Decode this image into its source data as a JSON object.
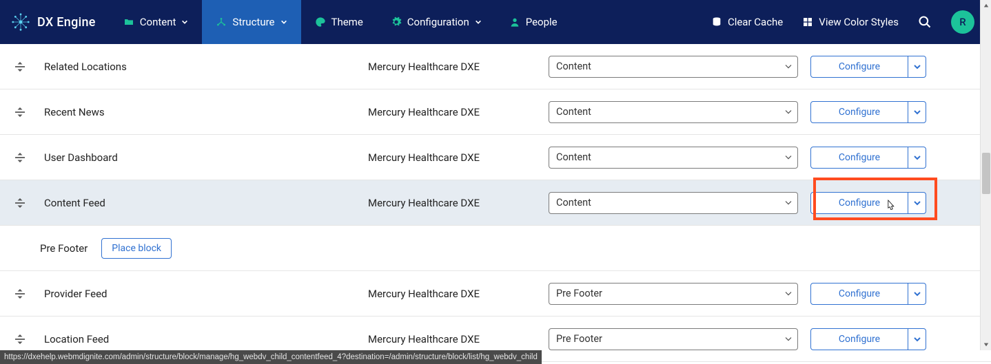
{
  "brand": "DX Engine",
  "nav": {
    "content": "Content",
    "structure": "Structure",
    "theme": "Theme",
    "configuration": "Configuration",
    "people": "People"
  },
  "utils": {
    "clear_cache": "Clear Cache",
    "color_styles": "View Color Styles"
  },
  "avatar_initial": "R",
  "rows": [
    {
      "title": "Related Locations",
      "category": "Mercury Healthcare DXE",
      "region": "Content",
      "op": "Configure"
    },
    {
      "title": "Recent News",
      "category": "Mercury Healthcare DXE",
      "region": "Content",
      "op": "Configure"
    },
    {
      "title": "User Dashboard",
      "category": "Mercury Healthcare DXE",
      "region": "Content",
      "op": "Configure"
    },
    {
      "title": "Content Feed",
      "category": "Mercury Healthcare DXE",
      "region": "Content",
      "op": "Configure"
    },
    {
      "title": "Provider Feed",
      "category": "Mercury Healthcare DXE",
      "region": "Pre Footer",
      "op": "Configure"
    },
    {
      "title": "Location Feed",
      "category": "Mercury Healthcare DXE",
      "region": "Pre Footer",
      "op": "Configure"
    }
  ],
  "section": {
    "prefooter_title": "Pre Footer",
    "place_block": "Place block"
  },
  "status_url": "https://dxehelp.webmdignite.com/admin/structure/block/manage/hg_webdv_child_contentfeed_4?destination=/admin/structure/block/list/hg_webdv_child"
}
